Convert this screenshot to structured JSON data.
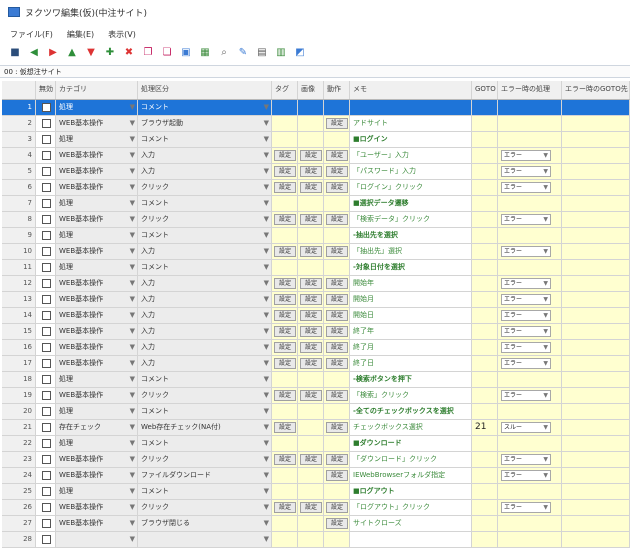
{
  "window": {
    "title": "ヌクツワ編集(仮)(中注サイト)"
  },
  "menu": {
    "items": [
      "ファイル(F)",
      "編集(E)",
      "表示(V)"
    ]
  },
  "pathbar": {
    "text": "00 : 仮想注サイト"
  },
  "columns": {
    "row_num": "",
    "check": "無効",
    "category": "カテゴリ",
    "process": "処理区分",
    "tag": "タグ",
    "image": "画像",
    "action": "動作",
    "memo": "メモ",
    "goto": "GOTO",
    "on_error": "エラー時の処理",
    "on_error_goto": "エラー時のGOTO先"
  },
  "setting_label": "設定",
  "rows": [
    {
      "n": "1",
      "cat": "処理",
      "proc": "コメント",
      "tag": false,
      "img": false,
      "act": false,
      "memo": "",
      "sect": true,
      "goto": "",
      "err": ""
    },
    {
      "n": "2",
      "cat": "WEB基本操作",
      "proc": "ブラウザ起動",
      "tag": false,
      "img": false,
      "act": true,
      "memo": "アドサイト",
      "sect": false,
      "goto": "",
      "err": ""
    },
    {
      "n": "3",
      "cat": "処理",
      "proc": "コメント",
      "tag": false,
      "img": false,
      "act": false,
      "memo": "■ログイン",
      "sect": true,
      "goto": "",
      "err": ""
    },
    {
      "n": "4",
      "cat": "WEB基本操作",
      "proc": "入力",
      "tag": true,
      "img": true,
      "act": true,
      "memo": "「ユーザー」入力",
      "sect": false,
      "goto": "",
      "err": "エラー"
    },
    {
      "n": "5",
      "cat": "WEB基本操作",
      "proc": "入力",
      "tag": true,
      "img": true,
      "act": true,
      "memo": "「パスワード」入力",
      "sect": false,
      "goto": "",
      "err": "エラー"
    },
    {
      "n": "6",
      "cat": "WEB基本操作",
      "proc": "クリック",
      "tag": true,
      "img": true,
      "act": true,
      "memo": "「ログイン」クリック",
      "sect": false,
      "goto": "",
      "err": "エラー"
    },
    {
      "n": "7",
      "cat": "処理",
      "proc": "コメント",
      "tag": false,
      "img": false,
      "act": false,
      "memo": "■選択データ遷移",
      "sect": true,
      "goto": "",
      "err": ""
    },
    {
      "n": "8",
      "cat": "WEB基本操作",
      "proc": "クリック",
      "tag": true,
      "img": true,
      "act": true,
      "memo": "「検索データ」クリック",
      "sect": false,
      "goto": "",
      "err": "エラー"
    },
    {
      "n": "9",
      "cat": "処理",
      "proc": "コメント",
      "tag": false,
      "img": false,
      "act": false,
      "memo": "-抽出先を選択",
      "sect": true,
      "goto": "",
      "err": ""
    },
    {
      "n": "10",
      "cat": "WEB基本操作",
      "proc": "入力",
      "tag": true,
      "img": true,
      "act": true,
      "memo": "「抽出先」選択",
      "sect": false,
      "goto": "",
      "err": "エラー"
    },
    {
      "n": "11",
      "cat": "処理",
      "proc": "コメント",
      "tag": false,
      "img": false,
      "act": false,
      "memo": "-対象日付を選択",
      "sect": true,
      "goto": "",
      "err": ""
    },
    {
      "n": "12",
      "cat": "WEB基本操作",
      "proc": "入力",
      "tag": true,
      "img": true,
      "act": true,
      "memo": "開始年",
      "sect": false,
      "goto": "",
      "err": "エラー"
    },
    {
      "n": "13",
      "cat": "WEB基本操作",
      "proc": "入力",
      "tag": true,
      "img": true,
      "act": true,
      "memo": "開始月",
      "sect": false,
      "goto": "",
      "err": "エラー"
    },
    {
      "n": "14",
      "cat": "WEB基本操作",
      "proc": "入力",
      "tag": true,
      "img": true,
      "act": true,
      "memo": "開始日",
      "sect": false,
      "goto": "",
      "err": "エラー"
    },
    {
      "n": "15",
      "cat": "WEB基本操作",
      "proc": "入力",
      "tag": true,
      "img": true,
      "act": true,
      "memo": "終了年",
      "sect": false,
      "goto": "",
      "err": "エラー"
    },
    {
      "n": "16",
      "cat": "WEB基本操作",
      "proc": "入力",
      "tag": true,
      "img": true,
      "act": true,
      "memo": "終了月",
      "sect": false,
      "goto": "",
      "err": "エラー"
    },
    {
      "n": "17",
      "cat": "WEB基本操作",
      "proc": "入力",
      "tag": true,
      "img": true,
      "act": true,
      "memo": "終了日",
      "sect": false,
      "goto": "",
      "err": "エラー"
    },
    {
      "n": "18",
      "cat": "処理",
      "proc": "コメント",
      "tag": false,
      "img": false,
      "act": false,
      "memo": "-検索ボタンを押下",
      "sect": true,
      "goto": "",
      "err": ""
    },
    {
      "n": "19",
      "cat": "WEB基本操作",
      "proc": "クリック",
      "tag": true,
      "img": true,
      "act": true,
      "memo": "「検索」クリック",
      "sect": false,
      "goto": "",
      "err": "エラー"
    },
    {
      "n": "20",
      "cat": "処理",
      "proc": "コメント",
      "tag": false,
      "img": false,
      "act": false,
      "memo": "-全てのチェックボックスを選択",
      "sect": true,
      "goto": "",
      "err": ""
    },
    {
      "n": "21",
      "cat": "存在チェック",
      "proc": "Web存在チェック(NA付)",
      "tag": true,
      "img": false,
      "act": true,
      "memo": "チェックボックス選択",
      "sect": false,
      "goto": "21",
      "err": "スルー"
    },
    {
      "n": "22",
      "cat": "処理",
      "proc": "コメント",
      "tag": false,
      "img": false,
      "act": false,
      "memo": "■ダウンロード",
      "sect": true,
      "goto": "",
      "err": ""
    },
    {
      "n": "23",
      "cat": "WEB基本操作",
      "proc": "クリック",
      "tag": true,
      "img": true,
      "act": true,
      "memo": "「ダウンロード」クリック",
      "sect": false,
      "goto": "",
      "err": "エラー"
    },
    {
      "n": "24",
      "cat": "WEB基本操作",
      "proc": "ファイルダウンロード",
      "tag": false,
      "img": false,
      "act": true,
      "memo": "IEWebBrowserフォルダ指定",
      "sect": false,
      "goto": "",
      "err": "エラー"
    },
    {
      "n": "25",
      "cat": "処理",
      "proc": "コメント",
      "tag": false,
      "img": false,
      "act": false,
      "memo": "■ログアウト",
      "sect": true,
      "goto": "",
      "err": ""
    },
    {
      "n": "26",
      "cat": "WEB基本操作",
      "proc": "クリック",
      "tag": true,
      "img": true,
      "act": true,
      "memo": "「ログアウト」クリック",
      "sect": false,
      "goto": "",
      "err": "エラー"
    },
    {
      "n": "27",
      "cat": "WEB基本操作",
      "proc": "ブラウザ閉じる",
      "tag": false,
      "img": false,
      "act": true,
      "memo": "サイトクローズ",
      "sect": false,
      "goto": "",
      "err": ""
    },
    {
      "n": "28",
      "cat": "",
      "proc": "",
      "tag": false,
      "img": false,
      "act": false,
      "memo": "",
      "sect": false,
      "goto": "",
      "err": ""
    }
  ]
}
